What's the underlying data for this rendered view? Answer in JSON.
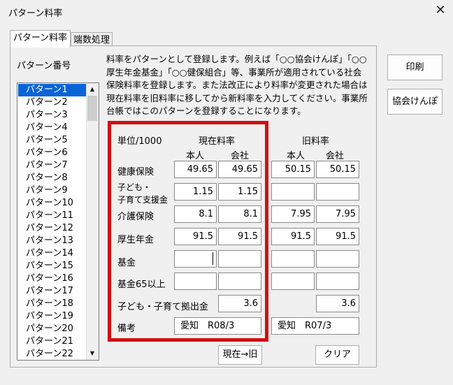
{
  "window": {
    "title": "パターン料率",
    "close_glyph": "✕"
  },
  "tabs": [
    {
      "label": "パターン料率"
    },
    {
      "label": "端数処理"
    }
  ],
  "pattern_list": {
    "label": "パターン番号",
    "items": [
      "パターン1",
      "パターン2",
      "パターン3",
      "パターン4",
      "パターン5",
      "パターン6",
      "パターン7",
      "パターン8",
      "パターン9",
      "パターン10",
      "パターン11",
      "パターン12",
      "パターン13",
      "パターン14",
      "パターン15",
      "パターン16",
      "パターン17",
      "パターン18",
      "パターン19",
      "パターン20",
      "パターン21",
      "パターン22"
    ],
    "selected": "パターン1",
    "scroll_up": "▲",
    "scroll_down": "▼"
  },
  "description": "料率をパターンとして登録します。例えば「○○協会けんぽ」「○○厚生年金基金」「○○健保組合」等、事業所が適用されている社会保険料率を登録します。また法改正により料率が変更された場合は現在料率を旧料率に移してから新料率を入力してください。事業所台帳ではこのパターンを登録することになります。",
  "grid": {
    "unit_label": "単位/1000",
    "current_label": "現在料率",
    "old_label": "旧料率",
    "col_person": "本人",
    "col_company": "会社",
    "rows": [
      {
        "label": "健康保険",
        "current_person": "49.65",
        "current_company": "49.65",
        "old_person": "50.15",
        "old_company": "50.15"
      },
      {
        "label_line1": "子ども・",
        "label_line2": "子育て支援金",
        "current_person": "1.15",
        "current_company": "1.15",
        "old_person": "",
        "old_company": ""
      },
      {
        "label": "介護保険",
        "current_person": "8.1",
        "current_company": "8.1",
        "old_person": "7.95",
        "old_company": "7.95"
      },
      {
        "label": "厚生年金",
        "current_person": "91.5",
        "current_company": "91.5",
        "old_person": "91.5",
        "old_company": "91.5"
      },
      {
        "label": "基金",
        "current_person": "",
        "current_company": "",
        "old_person": "",
        "old_company": ""
      },
      {
        "label": "基金65以上",
        "current_person": "",
        "current_company": "",
        "old_person": "",
        "old_company": ""
      }
    ],
    "contribution": {
      "label": "子ども・子育て拠出金",
      "current": "3.6",
      "old": "3.6"
    },
    "remarks": {
      "label": "備考",
      "current": "愛知　R08/3",
      "old": "愛知　R07/3"
    }
  },
  "buttons": {
    "print": "印刷",
    "kyokai": "協会けんぽ",
    "move_to_old": "現在→旧",
    "clear": "クリア"
  },
  "colors": {
    "highlight_border": "#d01010",
    "selection": "#0a64d8"
  }
}
